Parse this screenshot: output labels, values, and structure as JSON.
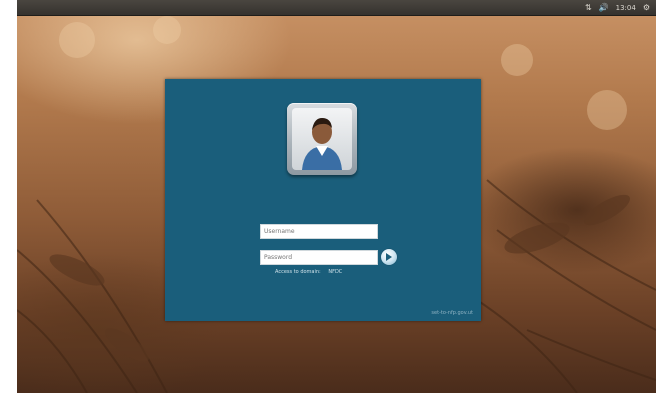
{
  "topbar": {
    "tray_icons": [
      "keyboard-layout-icon",
      "volume-icon",
      "power-icon"
    ],
    "clock": "13:04"
  },
  "login": {
    "username_placeholder": "Username",
    "password_placeholder": "Password",
    "domain_label": "Access to domain:",
    "domain_value": "NFDC",
    "footer": "set-to-nfp.gov.ut"
  },
  "colors": {
    "panel": "#1a5e7b",
    "topbar": "#3c3935"
  }
}
